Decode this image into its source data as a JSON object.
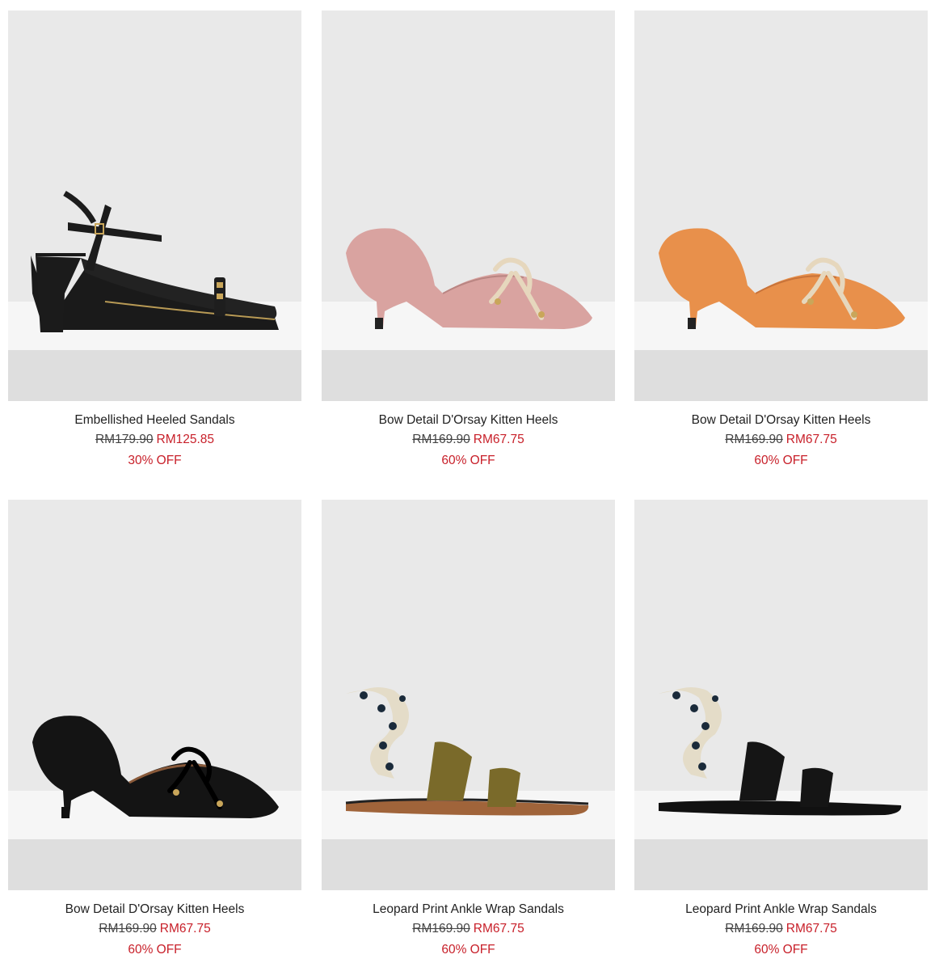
{
  "colors": {
    "sale_red": "#c8202a",
    "text": "#222222",
    "background": "#ffffff",
    "photo_backdrop": "#e9e9e9"
  },
  "products": [
    {
      "name": "Embellished Heeled Sandals",
      "original_price": "RM179.90",
      "sale_price": "RM125.85",
      "discount": "30% OFF",
      "image": "black-heeled-sandal"
    },
    {
      "name": "Bow Detail D'Orsay Kitten Heels",
      "original_price": "RM169.90",
      "sale_price": "RM67.75",
      "discount": "60% OFF",
      "image": "pink-kitten-heel"
    },
    {
      "name": "Bow Detail D'Orsay Kitten Heels",
      "original_price": "RM169.90",
      "sale_price": "RM67.75",
      "discount": "60% OFF",
      "image": "orange-kitten-heel"
    },
    {
      "name": "Bow Detail D'Orsay Kitten Heels",
      "original_price": "RM169.90",
      "sale_price": "RM67.75",
      "discount": "60% OFF",
      "image": "black-kitten-heel"
    },
    {
      "name": "Leopard Print Ankle Wrap Sandals",
      "original_price": "RM169.90",
      "sale_price": "RM67.75",
      "discount": "60% OFF",
      "image": "olive-wrap-sandal"
    },
    {
      "name": "Leopard Print Ankle Wrap Sandals",
      "original_price": "RM169.90",
      "sale_price": "RM67.75",
      "discount": "60% OFF",
      "image": "black-wrap-sandal"
    }
  ]
}
